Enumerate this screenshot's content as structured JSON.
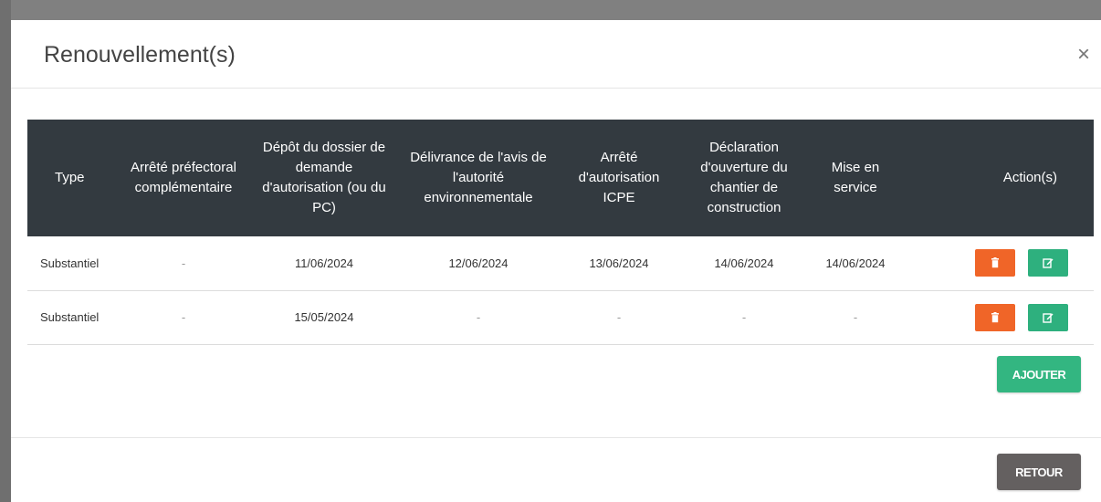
{
  "modal": {
    "title": "Renouvellement(s)",
    "close_symbol": "×"
  },
  "table": {
    "headers": [
      "Type",
      "Arrêté préfectoral complémentaire",
      "Dépôt du dossier de demande d'autorisation (ou du PC)",
      "Délivrance de l'avis de l'autorité environnementale",
      "Arrêté d'autorisation ICPE",
      "Déclaration d'ouverture du chantier de construction",
      "Mise en service",
      "Action(s)"
    ],
    "rows": [
      [
        "Substantiel",
        "-",
        "11/06/2024",
        "12/06/2024",
        "13/06/2024",
        "14/06/2024",
        "14/06/2024"
      ],
      [
        "Substantiel",
        "-",
        "15/05/2024",
        "-",
        "-",
        "-",
        "-"
      ]
    ]
  },
  "actions": {
    "delete_icon": "trash-icon",
    "edit_icon": "edit-icon"
  },
  "buttons": {
    "add_label": "AJOUTER",
    "back_label": "RETOUR"
  },
  "colors": {
    "header_bg": "#333a40",
    "delete": "#f06528",
    "edit": "#2eb07e",
    "add": "#33b681",
    "back": "#646060"
  }
}
